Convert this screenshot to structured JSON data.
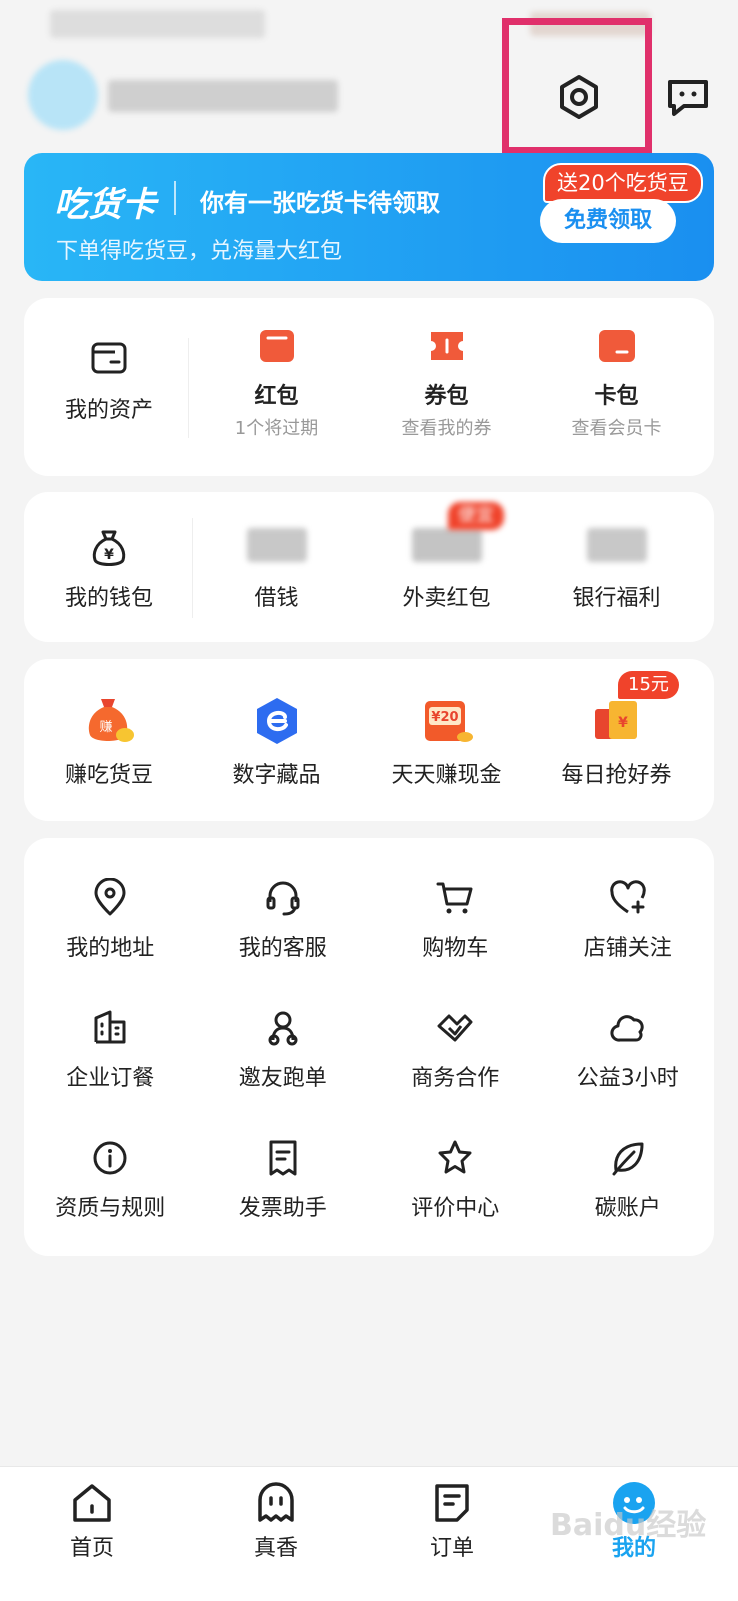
{
  "header": {
    "status_blur": "",
    "username_blur": ""
  },
  "promo": {
    "logo": "吃货卡",
    "title": "你有一张吃货卡待领取",
    "subtitle": "下单得吃货豆，兑海量大红包",
    "badge": "送20个吃货豆",
    "cta": "免费领取"
  },
  "assets": {
    "main_label": "我的资产",
    "items": [
      {
        "label": "红包",
        "sub": "1个将过期"
      },
      {
        "label": "券包",
        "sub": "查看我的券"
      },
      {
        "label": "卡包",
        "sub": "查看会员卡"
      }
    ]
  },
  "wallet": {
    "main_label": "我的钱包",
    "items": [
      {
        "label": "借钱"
      },
      {
        "label": "外卖红包",
        "badge": "便宜"
      },
      {
        "label": "银行福利"
      }
    ]
  },
  "earn": {
    "items": [
      {
        "label": "赚吃货豆",
        "icon": "money-bag-icon"
      },
      {
        "label": "数字藏品",
        "icon": "digital-collectible-icon"
      },
      {
        "label": "天天赚现金",
        "icon": "cash-envelope-icon",
        "icon_text": "¥20"
      },
      {
        "label": "每日抢好券",
        "icon": "coupon-icon",
        "badge": "15元"
      }
    ]
  },
  "services": {
    "items": [
      {
        "label": "我的地址",
        "icon": "location-icon"
      },
      {
        "label": "我的客服",
        "icon": "headset-icon"
      },
      {
        "label": "购物车",
        "icon": "cart-icon"
      },
      {
        "label": "店铺关注",
        "icon": "heart-plus-icon"
      },
      {
        "label": "企业订餐",
        "icon": "building-icon"
      },
      {
        "label": "邀友跑单",
        "icon": "rider-icon"
      },
      {
        "label": "商务合作",
        "icon": "handshake-icon"
      },
      {
        "label": "公益3小时",
        "icon": "cloud-icon"
      },
      {
        "label": "资质与规则",
        "icon": "info-icon"
      },
      {
        "label": "发票助手",
        "icon": "receipt-icon"
      },
      {
        "label": "评价中心",
        "icon": "star-icon"
      },
      {
        "label": "碳账户",
        "icon": "leaf-icon"
      }
    ]
  },
  "nav": {
    "items": [
      {
        "label": "首页",
        "icon": "home-icon"
      },
      {
        "label": "真香",
        "icon": "ghost-icon"
      },
      {
        "label": "订单",
        "icon": "order-icon"
      },
      {
        "label": "我的",
        "icon": "profile-icon"
      }
    ],
    "active": "我的"
  },
  "colors": {
    "accent_blue": "#1aa3f0",
    "highlight_box": "#e0306b",
    "red_badge": "#f0432b"
  },
  "watermark": "Baidu经验"
}
